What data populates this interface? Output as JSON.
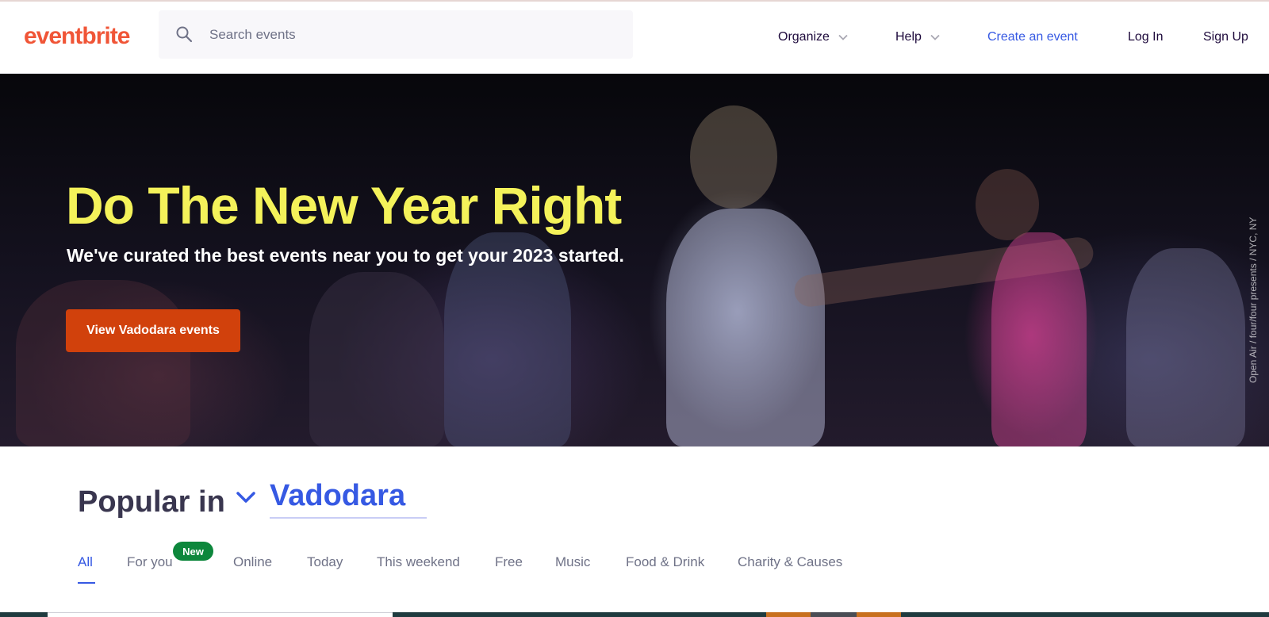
{
  "header": {
    "logo": "eventbrite",
    "search": {
      "placeholder": "Search events",
      "value": ""
    },
    "nav": {
      "organize": "Organize",
      "help": "Help",
      "create": "Create an event",
      "login": "Log In",
      "signup": "Sign Up"
    }
  },
  "hero": {
    "title": "Do The New Year Right",
    "subtitle": "We've curated the best events near you to get your 2023 started.",
    "cta": "View Vadodara events",
    "credit": "Open Air / four/four presents / NYC, NY"
  },
  "popular": {
    "label": "Popular in",
    "city": "Vadodara"
  },
  "tabs": [
    {
      "label": "All",
      "active": true
    },
    {
      "label": "For you",
      "badge": "New"
    },
    {
      "label": "Online"
    },
    {
      "label": "Today"
    },
    {
      "label": "This weekend"
    },
    {
      "label": "Free"
    },
    {
      "label": "Music"
    },
    {
      "label": "Food & Drink"
    },
    {
      "label": "Charity & Causes"
    }
  ],
  "colors": {
    "brand": "#f05537",
    "link": "#3659e3",
    "hero_title": "#f4f25a",
    "cta": "#d1410c",
    "badge": "#0d873c"
  }
}
